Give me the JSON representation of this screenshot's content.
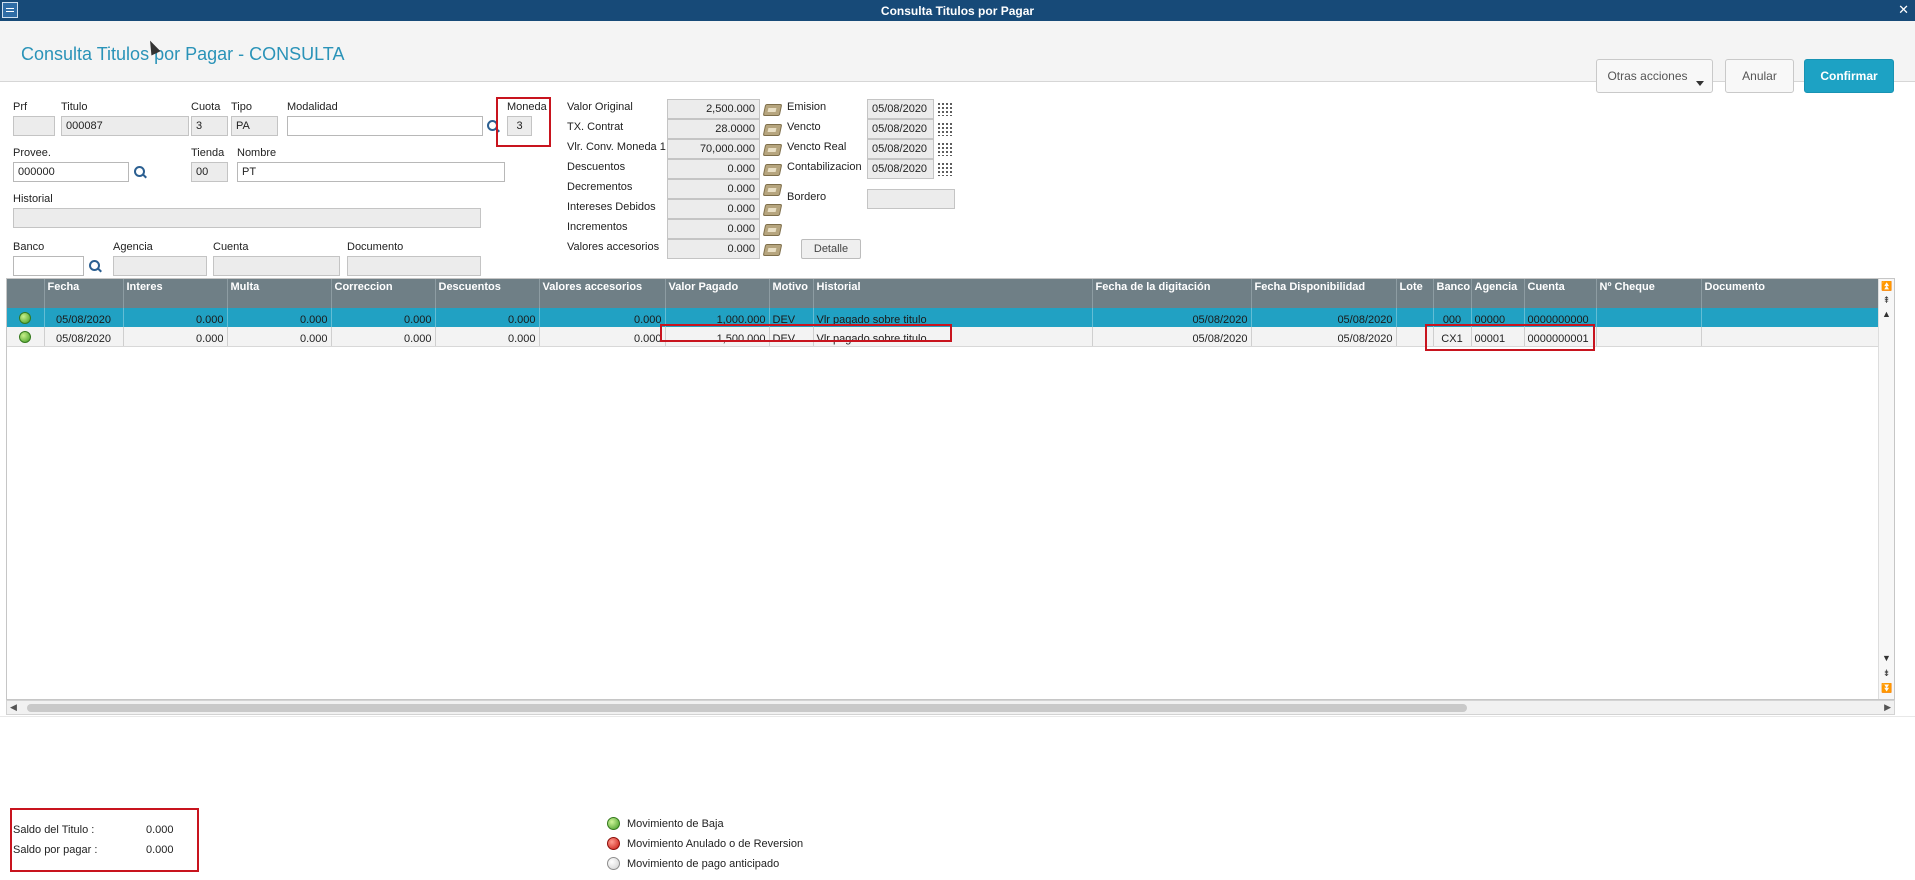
{
  "window": {
    "title": "Consulta Titulos por Pagar"
  },
  "header": {
    "title": "Consulta Titulos por Pagar - CONSULTA",
    "otras_acciones": "Otras acciones",
    "anular": "Anular",
    "confirmar": "Confirmar"
  },
  "form": {
    "prf": {
      "label": "Prf",
      "value": ""
    },
    "titulo": {
      "label": "Titulo",
      "value": "000087"
    },
    "cuota": {
      "label": "Cuota",
      "value": "3"
    },
    "tipo": {
      "label": "Tipo",
      "value": "PA"
    },
    "modalidad": {
      "label": "Modalidad",
      "value": ""
    },
    "moneda": {
      "label": "Moneda",
      "value": "3"
    },
    "provee": {
      "label": "Provee.",
      "value": "000000"
    },
    "tienda": {
      "label": "Tienda",
      "value": "00"
    },
    "nombre": {
      "label": "Nombre",
      "value": "PT"
    },
    "historial": {
      "label": "Historial",
      "value": ""
    },
    "banco": {
      "label": "Banco",
      "value": ""
    },
    "agencia": {
      "label": "Agencia",
      "value": ""
    },
    "cuenta": {
      "label": "Cuenta",
      "value": ""
    },
    "documento": {
      "label": "Documento",
      "value": ""
    }
  },
  "values": [
    {
      "label": "Valor Original",
      "value": "2,500.000"
    },
    {
      "label": "TX. Contrat",
      "value": "28.0000"
    },
    {
      "label": "Vlr. Conv. Moneda 1",
      "value": "70,000.000"
    },
    {
      "label": "Descuentos",
      "value": "0.000"
    },
    {
      "label": "Decrementos",
      "value": "0.000"
    },
    {
      "label": "Intereses Debidos",
      "value": "0.000"
    },
    {
      "label": "Incrementos",
      "value": "0.000"
    },
    {
      "label": "Valores accesorios",
      "value": "0.000"
    }
  ],
  "dates": [
    {
      "label": "Emision",
      "value": "05/08/2020"
    },
    {
      "label": "Vencto",
      "value": "05/08/2020"
    },
    {
      "label": "Vencto Real",
      "value": "05/08/2020"
    },
    {
      "label": "Contabilizacion",
      "value": "05/08/2020"
    }
  ],
  "bordero": {
    "label": "Bordero",
    "value": ""
  },
  "detalle": "Detalle",
  "grid": {
    "columns": [
      "",
      "Fecha",
      "Interes",
      "Multa",
      "Correccion",
      "Descuentos",
      "Valores accesorios",
      "Valor Pagado",
      "Motivo",
      "Historial",
      "Fecha de la digitación",
      "Fecha Disponibilidad",
      "Lote",
      "Banco",
      "Agencia",
      "Cuenta",
      "Nº Cheque",
      "Documento"
    ],
    "rows": [
      {
        "status": "green",
        "cells": [
          "05/08/2020",
          "0.000",
          "0.000",
          "0.000",
          "0.000",
          "0.000",
          "1,000.000",
          "DEV",
          "Vlr pagado sobre titulo",
          "05/08/2020",
          "05/08/2020",
          "",
          "000",
          "00000",
          "0000000000",
          "",
          ""
        ]
      },
      {
        "status": "green",
        "cells": [
          "05/08/2020",
          "0.000",
          "0.000",
          "0.000",
          "0.000",
          "0.000",
          "1,500.000",
          "DEV",
          "Vlr pagado sobre titulo",
          "05/08/2020",
          "05/08/2020",
          "",
          "CX1",
          "00001",
          "0000000001",
          "",
          ""
        ]
      }
    ]
  },
  "saldo": {
    "titulo_label": "Saldo del Titulo :",
    "titulo_value": "0.000",
    "pagar_label": "Saldo por pagar  :",
    "pagar_value": "0.000"
  },
  "legend": [
    {
      "label": "Movimiento de Baja",
      "color": "#3f9a23"
    },
    {
      "label": "Movimiento Anulado o de Reversion",
      "color": "#c9160e"
    },
    {
      "label": "Movimiento de pago anticipado",
      "color": "#cfcfcf"
    }
  ]
}
